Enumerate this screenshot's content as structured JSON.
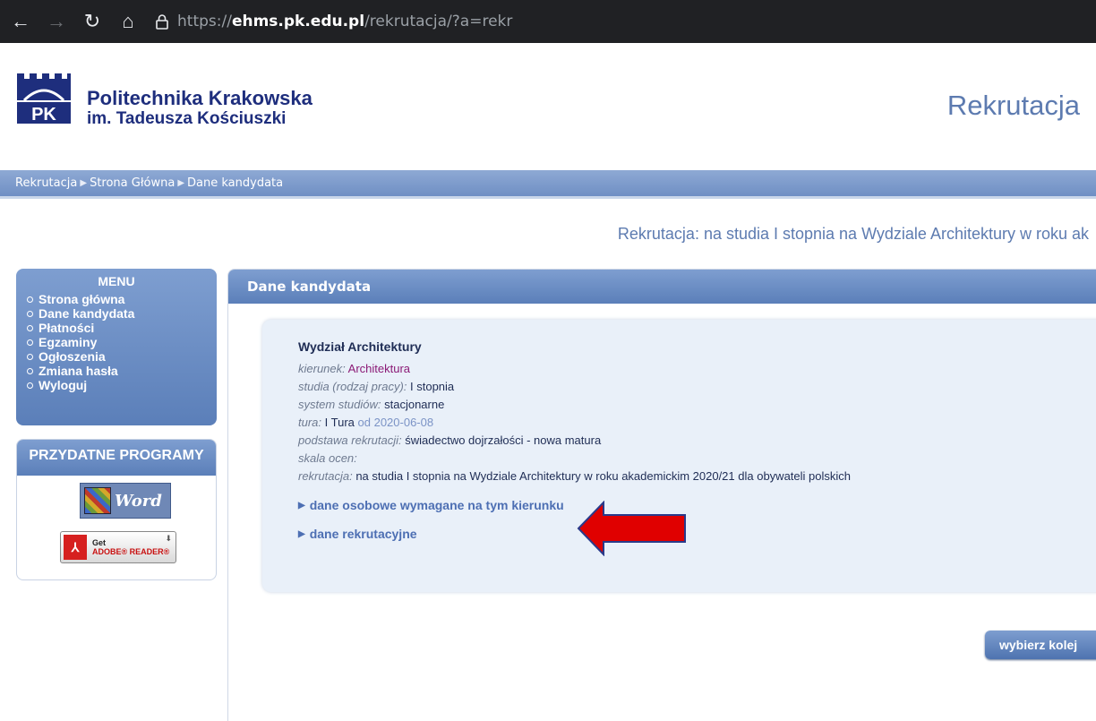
{
  "browser": {
    "url_scheme": "https://",
    "url_host": "ehms.pk.edu.pl",
    "url_path": "/rekrutacja/?a=rekr"
  },
  "header": {
    "logo_line1": "Politechnika Krakowska",
    "logo_line2": "im. Tadeusza Kościuszki",
    "title": "Rekrutacja"
  },
  "breadcrumb": [
    "Rekrutacja",
    "Strona Główna",
    "Dane kandydata"
  ],
  "subtitle": "Rekrutacja: na studia I stopnia na Wydziale Architektury w roku ak",
  "menu": {
    "title": "MENU",
    "items": [
      "Strona główna",
      "Dane kandydata",
      "Płatności",
      "Egzaminy",
      "Ogłoszenia",
      "Zmiana hasła",
      "Wyloguj"
    ]
  },
  "tools": {
    "title": "PRZYDATNE PROGRAMY",
    "word_label": "Word",
    "adobe_get": "Get",
    "adobe_name": "ADOBE® READER®"
  },
  "panel": {
    "title": "Dane kandydata",
    "faculty": "Wydział Architektury",
    "rows": {
      "kierunek": {
        "label": "kierunek:",
        "value": "Architektura"
      },
      "studia": {
        "label": "studia (rodzaj pracy):",
        "value": "I stopnia"
      },
      "system": {
        "label": "system studiów:",
        "value": "stacjonarne"
      },
      "tura": {
        "label": "tura:",
        "value": "I Tura",
        "date": "od 2020-06-08"
      },
      "podstawa": {
        "label": "podstawa rekrutacji:",
        "value": "świadectwo dojrzałości - nowa matura"
      },
      "skala": {
        "label": "skala ocen:",
        "value": ""
      },
      "rekrutacja": {
        "label": "rekrutacja:",
        "value": "na studia I stopnia na Wydziale Architektury w roku akademickim 2020/21 dla obywateli polskich"
      }
    },
    "toggle_personal": "dane osobowe wymagane na tym kierunku",
    "toggle_recruit": "dane rekrutacyjne",
    "choose_button": "wybierz kolej"
  },
  "colors": {
    "brand_blue": "#1e2e7d",
    "bar_blue": "#6f8fc4",
    "arrow_red": "#e00000"
  }
}
